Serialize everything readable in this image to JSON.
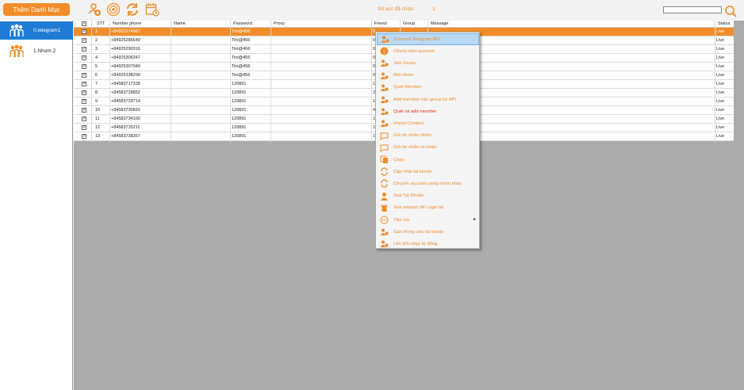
{
  "toolbar": {
    "add_category_label": "Thêm Danh Mục",
    "counter_label": "Số acc đã chọn:",
    "counter_value": "1",
    "search_value": ""
  },
  "sidebar": {
    "groups": [
      {
        "label": "0.telegram1"
      },
      {
        "label": "1.Nhom 2"
      }
    ]
  },
  "grid": {
    "headers": {
      "stt": "STT",
      "phone": "Number phone",
      "name": "Name",
      "password": "Password",
      "proxy": "Proxy",
      "friend": "Friend",
      "group": "Group",
      "message": "Message",
      "status": "Status"
    },
    "rows": [
      {
        "stt": "1",
        "phone": "+84925274987",
        "name": "",
        "password": "Tini@456",
        "friend": "0",
        "status": "Live"
      },
      {
        "stt": "2",
        "phone": "+84925286640",
        "name": "",
        "password": "Tini@456",
        "friend": "0",
        "status": "Live"
      },
      {
        "stt": "3",
        "phone": "+84925290316",
        "name": "",
        "password": "Tini@456",
        "friend": "0",
        "status": "Live"
      },
      {
        "stt": "4",
        "phone": "+84925306347",
        "name": "",
        "password": "Tini@456",
        "friend": "0",
        "status": "Live"
      },
      {
        "stt": "5",
        "phone": "+84925307040",
        "name": "",
        "password": "Tini@456",
        "friend": "0",
        "status": "Live"
      },
      {
        "stt": "6",
        "phone": "+84925338290",
        "name": "",
        "password": "Tini@456",
        "friend": "0",
        "status": "Live"
      },
      {
        "stt": "7",
        "phone": "+84583717338",
        "name": "",
        "password": "120891",
        "friend": "1",
        "status": "Live"
      },
      {
        "stt": "8",
        "phone": "+84583728852",
        "name": "",
        "password": "120891",
        "friend": "2",
        "status": "Live"
      },
      {
        "stt": "9",
        "phone": "+84583729714",
        "name": "",
        "password": "120891",
        "friend": "1",
        "status": "Live"
      },
      {
        "stt": "10",
        "phone": "+84583730691",
        "name": "",
        "password": "120891",
        "friend": "4",
        "status": "Live"
      },
      {
        "stt": "11",
        "phone": "+84583734100",
        "name": "",
        "password": "120891",
        "friend": "1",
        "status": "Live"
      },
      {
        "stt": "12",
        "phone": "+84583735211",
        "name": "",
        "password": "120891",
        "friend": "1",
        "status": "Live"
      },
      {
        "stt": "13",
        "phone": "+84583738357",
        "name": "",
        "password": "120891",
        "friend": "1",
        "status": "Live"
      }
    ]
  },
  "context_menu": {
    "items": [
      {
        "label": "Connect Telegram API"
      },
      {
        "label": "Check Infor account"
      },
      {
        "label": "Join Group"
      },
      {
        "label": "Rời nhóm"
      },
      {
        "label": "Quét Member"
      },
      {
        "label": "Add member vào group by API"
      },
      {
        "label": "Quét và add member"
      },
      {
        "label": "Import Contact"
      },
      {
        "label": "Gửi tin nhắn nhóm"
      },
      {
        "label": "Gửi tin nhắn cá nhân"
      },
      {
        "label": "Copy"
      },
      {
        "label": "Cập nhật tài khoản"
      },
      {
        "label": "Chuyển account sang nhóm khác"
      },
      {
        "label": "Xoá Tài Khoản"
      },
      {
        "label": "Xóa session để Login lại"
      },
      {
        "label": "Tiện ích"
      },
      {
        "label": "Gán Proxy cho tài khoản"
      },
      {
        "label": "Lên lịch chạy tự động"
      }
    ]
  },
  "colors": {
    "accent": "#f28c28",
    "selected_group": "#1e7bd6",
    "grid_background": "#ababab"
  }
}
